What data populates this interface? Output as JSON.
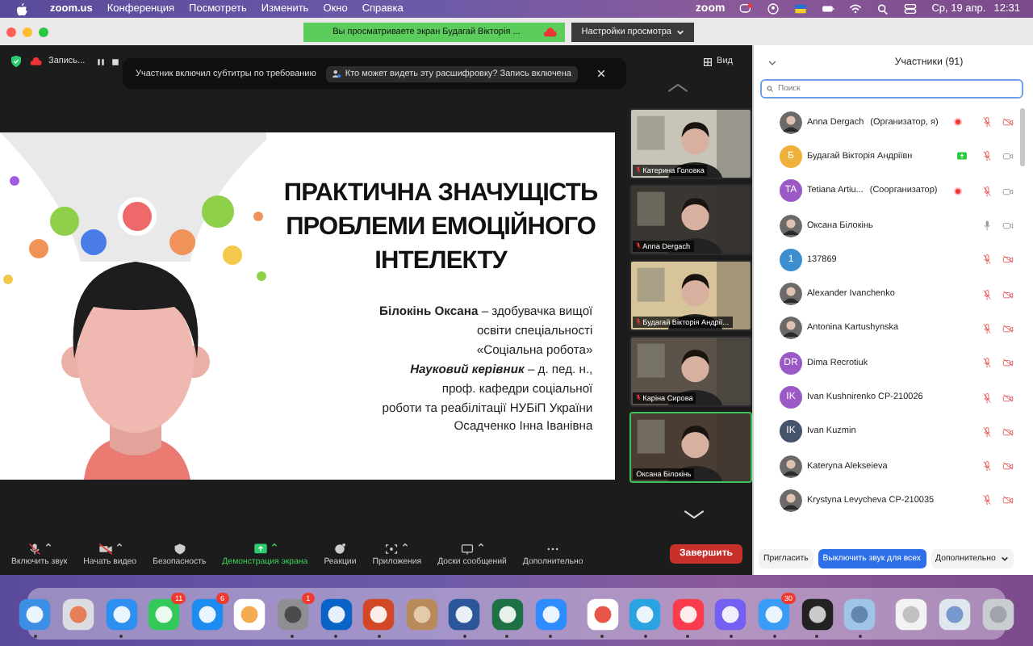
{
  "menu_bar": {
    "app": "zoom.us",
    "items": [
      "Конференция",
      "Посмотреть",
      "Изменить",
      "Окно",
      "Справка"
    ],
    "status_logo": "zoom",
    "date": "Ср, 19 апр.",
    "time": "12:31"
  },
  "title_bar": {
    "banner": "Вы просматриваете экран Будагай Вікторія ...",
    "view_settings": "Настройки просмотра"
  },
  "meeting": {
    "recording_label": "Запись...",
    "view_button": "Вид",
    "notice": {
      "text": "Участник включил субтитры по требованию",
      "link": "Кто может видеть эту расшифровку? Запись включена"
    }
  },
  "slide": {
    "title_lines": [
      "ПРАКТИЧНА ЗНАЧУЩІСТЬ",
      "ПРОБЛЕМИ ЕМОЦІЙНОГО",
      "ІНТЕЛЕКТУ"
    ],
    "body_lines": [
      "**Білокінь Оксана** – здобувачка вищої",
      "освіти спеціальності",
      "«Соціальна робота»",
      "*Науковий керівник* – д. пед. н.,",
      "проф. кафедри соціальної",
      "роботи та реабілітації НУБіП України",
      "Осадченко Інна Іванівна"
    ]
  },
  "video_tiles": [
    {
      "name": "Катерина Головка",
      "muted": true,
      "active": false
    },
    {
      "name": "Anna Dergach",
      "muted": true,
      "active": false
    },
    {
      "name": "Будагай Вікторія Андрії...",
      "muted": true,
      "active": false
    },
    {
      "name": "Каріна Сирова",
      "muted": true,
      "active": false
    },
    {
      "name": "Оксана Білокінь",
      "muted": false,
      "active": true
    }
  ],
  "toolbar": {
    "items": [
      {
        "kind": "mic-muted",
        "label": "Включить звук",
        "caret": true,
        "highlighted": false
      },
      {
        "kind": "video-off",
        "label": "Начать видео",
        "caret": true,
        "highlighted": false
      },
      {
        "kind": "shield",
        "label": "Безопасность",
        "caret": false,
        "highlighted": false
      },
      {
        "kind": "share",
        "label": "Демонстрация экрана",
        "caret": true,
        "highlighted": true
      },
      {
        "kind": "reactions",
        "label": "Реакции",
        "caret": false,
        "highlighted": false
      },
      {
        "kind": "apps",
        "label": "Приложения",
        "caret": true,
        "highlighted": false
      },
      {
        "kind": "whiteboard",
        "label": "Доски сообщений",
        "caret": true,
        "highlighted": false
      },
      {
        "kind": "more",
        "label": "Дополнительно",
        "caret": false,
        "highlighted": false
      }
    ],
    "end_button": "Завершить"
  },
  "participants": {
    "title": "Участники (91)",
    "search": {
      "placeholder": "Поиск"
    },
    "rows": [
      {
        "name": "Anna Dergach",
        "role": "(Организатор, я)",
        "recording": true,
        "mic_muted": true,
        "video_off": true
      },
      {
        "name": "Будагай Вікторія Андріївн",
        "avatar": {
          "kind": "initials",
          "text": "Б",
          "color": "#f0b03c"
        },
        "sharing": true,
        "mic_muted": true,
        "video_off": false
      },
      {
        "name": "Tetiana Artiu...",
        "role": "(Соорганизатор)",
        "avatar": {
          "kind": "initials",
          "text": "TA",
          "color": "#9b59c6"
        },
        "recording": true,
        "mic_muted": true,
        "video_off": false
      },
      {
        "name": "Оксана Білокінь",
        "mic_muted": false,
        "video_off": false
      },
      {
        "name": "137869",
        "avatar": {
          "kind": "initials",
          "text": "1",
          "color": "#3b8fd0"
        },
        "mic_muted": true,
        "video_off": true
      },
      {
        "name": "Alexander Ivanchenko",
        "mic_muted": true,
        "video_off": true
      },
      {
        "name": "Antonina Kartushynska",
        "mic_muted": true,
        "video_off": true
      },
      {
        "name": "Dima Recrotiuk",
        "avatar": {
          "kind": "initials",
          "text": "DR",
          "color": "#9b59c6"
        },
        "mic_muted": true,
        "video_off": true
      },
      {
        "name": "Ivan Kushnirenko CP-210026",
        "avatar": {
          "kind": "initials",
          "text": "IK",
          "color": "#9b59c6"
        },
        "mic_muted": true,
        "video_off": true
      },
      {
        "name": "Ivan Kuzmin",
        "avatar": {
          "kind": "initials",
          "text": "IK",
          "color": "#44546a"
        },
        "mic_muted": true,
        "video_off": true
      },
      {
        "name": "Kateryna Alekseieva",
        "mic_muted": true,
        "video_off": true
      },
      {
        "name": "Krystyna Levycheva CP-210035",
        "mic_muted": true,
        "video_off": true
      }
    ],
    "footer": {
      "invite": "Пригласить",
      "mute_all": "Выключить звук для всех",
      "more": "Дополнительно"
    }
  },
  "dock": {
    "groups": [
      [
        {
          "kind": "finder",
          "running": true
        },
        {
          "kind": "launchpad",
          "running": false
        },
        {
          "kind": "safari",
          "running": true
        },
        {
          "kind": "facetime",
          "badge": "11",
          "running": false
        },
        {
          "kind": "appstore",
          "badge": "6",
          "running": false
        },
        {
          "kind": "photos",
          "running": false
        },
        {
          "kind": "settings",
          "badge": "1",
          "running": true
        },
        {
          "kind": "outlook",
          "running": true
        },
        {
          "kind": "powerpoint",
          "running": true
        },
        {
          "kind": "contacts",
          "running": false
        },
        {
          "kind": "word",
          "running": true
        },
        {
          "kind": "excel",
          "running": true
        },
        {
          "kind": "zoom",
          "running": true
        }
      ],
      [
        {
          "kind": "chrome",
          "running": true
        },
        {
          "kind": "telegram",
          "running": true
        },
        {
          "kind": "music",
          "running": true
        },
        {
          "kind": "viber",
          "running": true
        },
        {
          "kind": "mail",
          "badge": "30",
          "running": true
        },
        {
          "kind": "terminal",
          "running": true
        },
        {
          "kind": "preview",
          "running": true
        }
      ],
      [
        {
          "kind": "document",
          "running": false
        },
        {
          "kind": "folder",
          "running": false
        },
        {
          "kind": "trash",
          "running": false
        }
      ]
    ]
  }
}
